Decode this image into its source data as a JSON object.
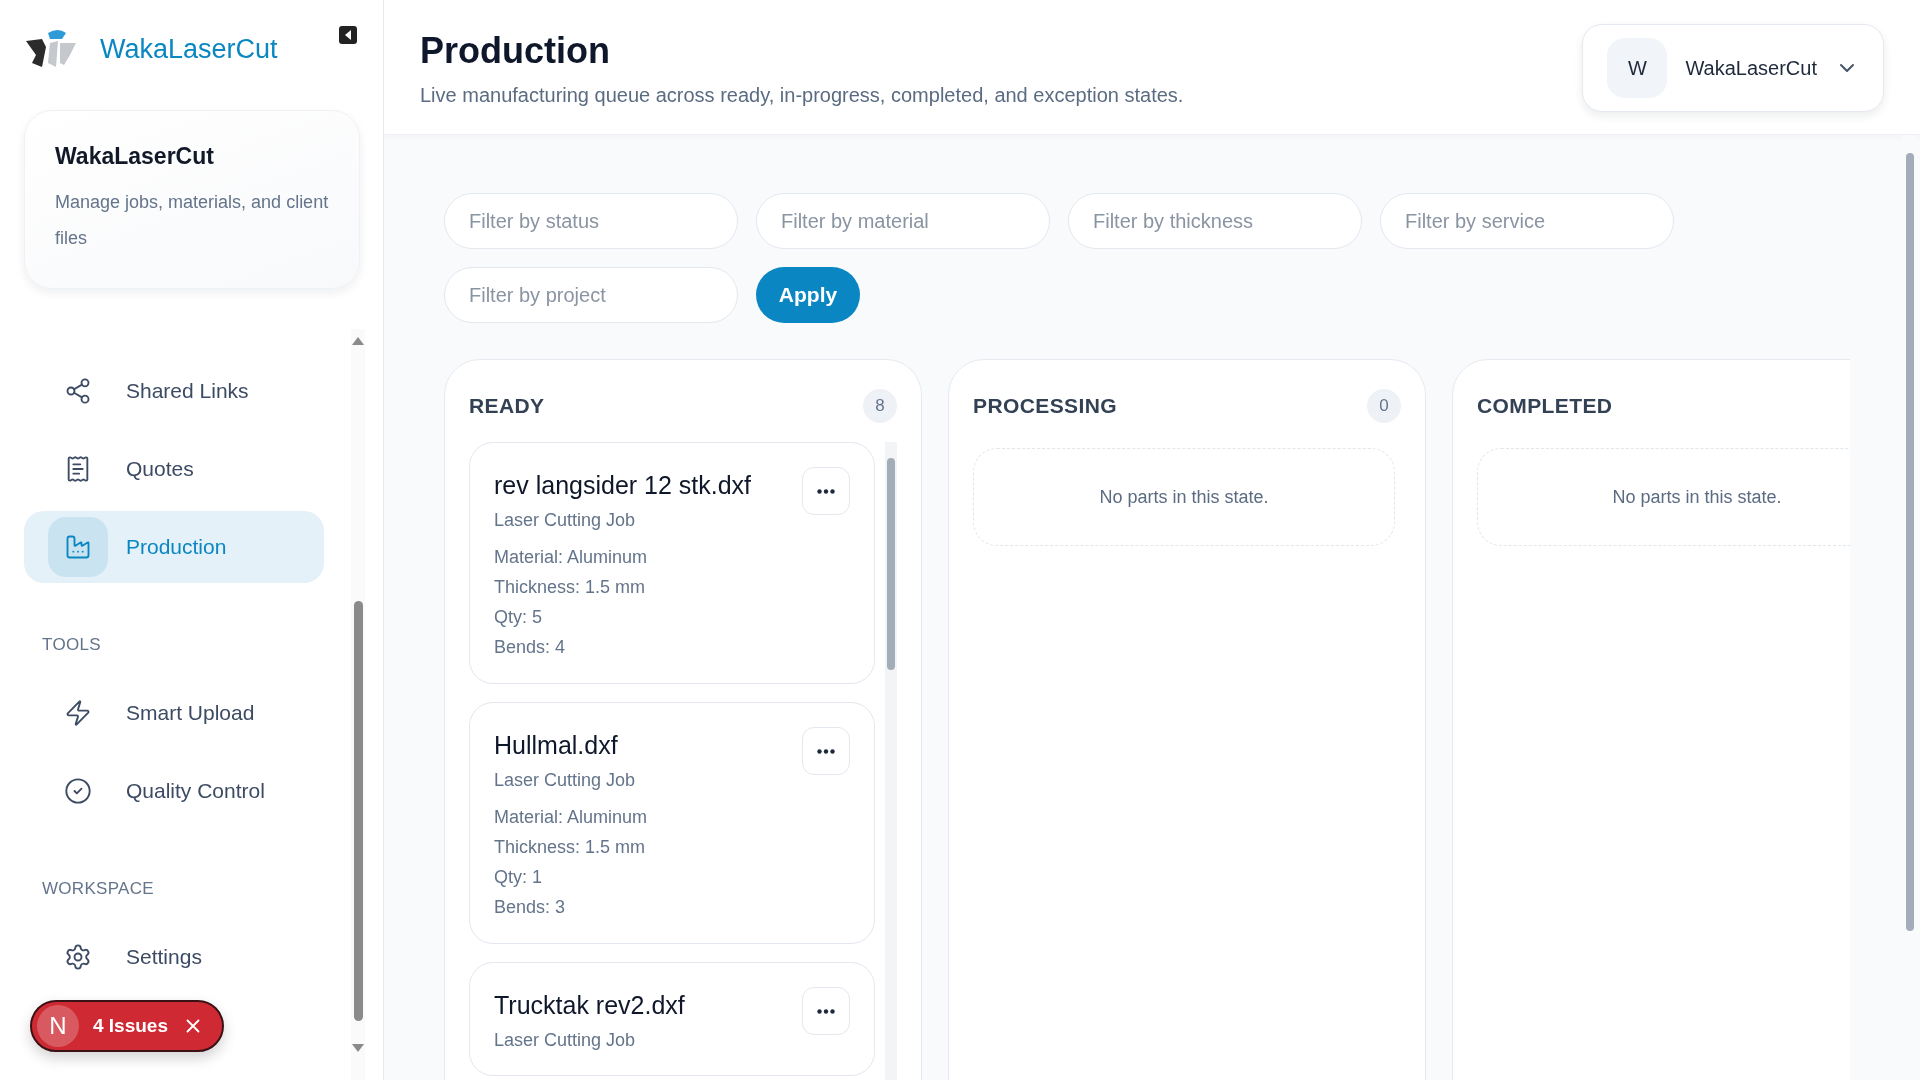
{
  "brand": {
    "name": "WakaLaserCut"
  },
  "workspace_card": {
    "title": "WakaLaserCut",
    "description": "Manage jobs, materials, and client files"
  },
  "sidebar": {
    "sections": [
      {
        "items": [
          {
            "kind": "share",
            "label": "Shared Links",
            "selected": false
          },
          {
            "kind": "quotes",
            "label": "Quotes",
            "selected": false
          },
          {
            "kind": "production",
            "label": "Production",
            "selected": true
          }
        ]
      },
      {
        "heading": "TOOLS",
        "items": [
          {
            "kind": "upload",
            "label": "Smart Upload",
            "selected": false
          },
          {
            "kind": "quality",
            "label": "Quality Control",
            "selected": false
          }
        ]
      },
      {
        "heading": "WORKSPACE",
        "items": [
          {
            "kind": "settings",
            "label": "Settings",
            "selected": false
          }
        ]
      }
    ]
  },
  "issues_badge": {
    "letter": "N",
    "label": "4 Issues"
  },
  "header": {
    "title": "Production",
    "subtitle": "Live manufacturing queue across ready, in-progress, completed, and exception states."
  },
  "account": {
    "initial": "W",
    "name": "WakaLaserCut"
  },
  "filters": [
    {
      "placeholder": "Filter by status"
    },
    {
      "placeholder": "Filter by material"
    },
    {
      "placeholder": "Filter by thickness"
    },
    {
      "placeholder": "Filter by service"
    },
    {
      "placeholder": "Filter by project"
    }
  ],
  "apply_button": "Apply",
  "columns": [
    {
      "title": "READY",
      "count": "8",
      "cards": [
        {
          "name": "rev langsider 12 stk.dxf",
          "type": "Laser Cutting Job",
          "details": [
            "Material: Aluminum",
            "Thickness: 1.5 mm",
            "Qty: 5",
            "Bends: 4"
          ]
        },
        {
          "name": "Hullmal.dxf",
          "type": "Laser Cutting Job",
          "details": [
            "Material: Aluminum",
            "Thickness: 1.5 mm",
            "Qty: 1",
            "Bends: 3"
          ]
        },
        {
          "name": "Trucktak rev2.dxf",
          "type": "Laser Cutting Job"
        }
      ]
    },
    {
      "title": "PROCESSING",
      "count": "0",
      "empty": "No parts in this state."
    },
    {
      "title": "COMPLETED",
      "empty": "No parts in this state."
    }
  ]
}
